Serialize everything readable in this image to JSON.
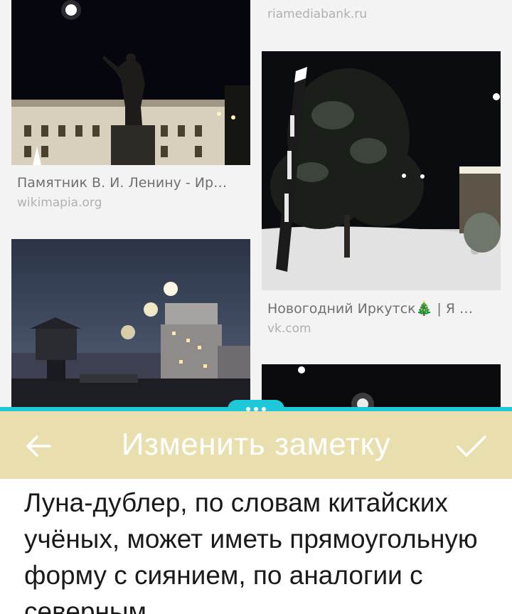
{
  "results": [
    {
      "title": "",
      "source": "riamediabank.ru"
    },
    {
      "title": "Памятник В. И. Ленину - Ир…",
      "source": "wikimapia.org"
    },
    {
      "title": "Новогодний Иркутск🎄 | Я …",
      "source": "vk.com"
    }
  ],
  "toolbar": {
    "title": "Изменить заметку",
    "back_icon": "arrow-left-icon",
    "confirm_icon": "checkmark-icon"
  },
  "note": {
    "text": "Луна-дублер, по словам китайских учёных, может иметь прямоугольную форму с  сиянием, по аналогии с северным"
  },
  "colors": {
    "accent": "#1fc8d8",
    "toolbar_bg": "#e9dfae",
    "toolbar_text": "#ffffff",
    "note_text": "#1a1a1a"
  }
}
